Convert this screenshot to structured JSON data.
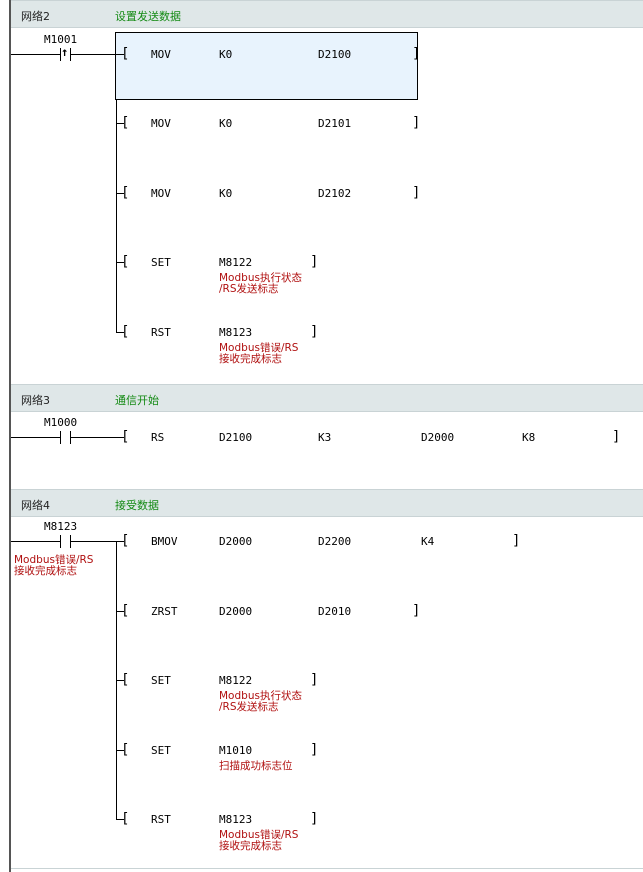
{
  "networks": [
    {
      "label": "网络2",
      "comment": "设置发送数据",
      "contact": {
        "device": "M1001",
        "type": "rising"
      },
      "rows": [
        {
          "op": "MOV",
          "args": [
            "K0",
            "D2100"
          ]
        },
        {
          "op": "MOV",
          "args": [
            "K0",
            "D2101"
          ]
        },
        {
          "op": "MOV",
          "args": [
            "K0",
            "D2102"
          ]
        },
        {
          "op": "SET",
          "args": [
            "M8122"
          ],
          "comment": "Modbus执行状态\n/RS发送标志"
        },
        {
          "op": "RST",
          "args": [
            "M8123"
          ],
          "comment": "Modbus错误/RS\n接收完成标志"
        }
      ]
    },
    {
      "label": "网络3",
      "comment": "通信开始",
      "contact": {
        "device": "M1000",
        "type": "no"
      },
      "rows": [
        {
          "op": "RS",
          "args": [
            "D2100",
            "K3",
            "D2000",
            "K8"
          ]
        }
      ]
    },
    {
      "label": "网络4",
      "comment": "接受数据",
      "contact": {
        "device": "M8123",
        "type": "no",
        "comment": "Modbus错误/RS\n接收完成标志"
      },
      "rows": [
        {
          "op": "BMOV",
          "args": [
            "D2000",
            "D2200",
            "K4"
          ]
        },
        {
          "op": "ZRST",
          "args": [
            "D2000",
            "D2010"
          ]
        },
        {
          "op": "SET",
          "args": [
            "M8122"
          ],
          "comment": "Modbus执行状态\n/RS发送标志"
        },
        {
          "op": "SET",
          "args": [
            "M1010"
          ],
          "comment": "扫描成功标志位"
        },
        {
          "op": "RST",
          "args": [
            "M8123"
          ],
          "comment": "Modbus错误/RS\n接收完成标志"
        }
      ]
    }
  ],
  "colors": {
    "header_bg": "#dfe7e8",
    "network_comment": "#138a13",
    "device_comment": "#b01010",
    "selection": "#e8f3fd"
  }
}
